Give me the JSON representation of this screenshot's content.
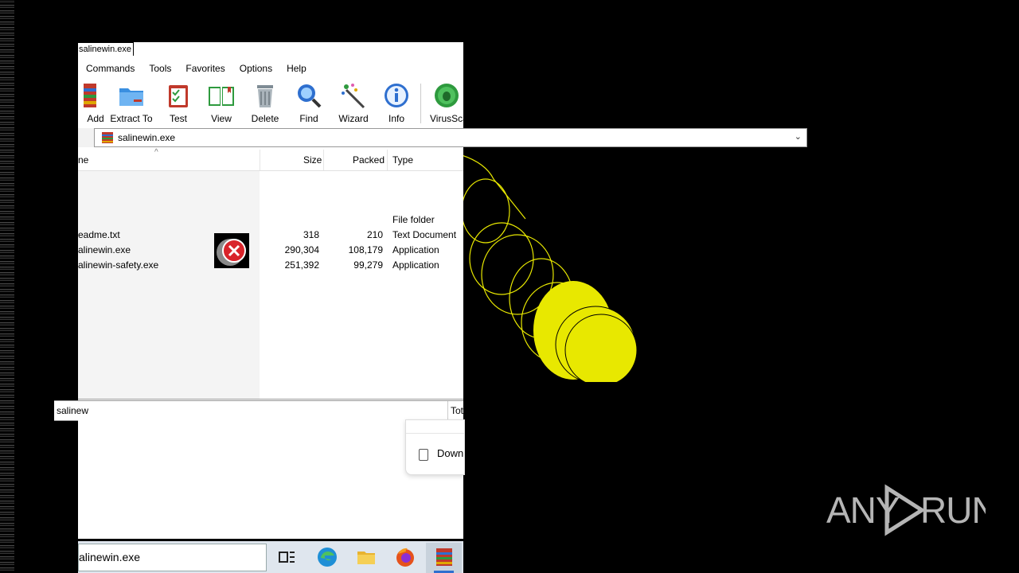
{
  "window": {
    "title": "salinewin.exe"
  },
  "menu": [
    "Commands",
    "Tools",
    "Favorites",
    "Options",
    "Help"
  ],
  "toolbar": [
    {
      "label": "Add",
      "icon": "add-archive-icon"
    },
    {
      "label": "Extract To",
      "icon": "extract-folder-icon"
    },
    {
      "label": "Test",
      "icon": "test-clipboard-icon"
    },
    {
      "label": "View",
      "icon": "view-book-icon"
    },
    {
      "label": "Delete",
      "icon": "trash-icon"
    },
    {
      "label": "Find",
      "icon": "magnifier-icon"
    },
    {
      "label": "Wizard",
      "icon": "wand-icon"
    },
    {
      "label": "Info",
      "icon": "info-icon"
    },
    {
      "label": "VirusSca",
      "icon": "virus-scan-icon"
    }
  ],
  "address": {
    "path": "salinewin.exe"
  },
  "columns": {
    "name": "ne",
    "size": "Size",
    "packed": "Packed",
    "type": "Type"
  },
  "files": [
    {
      "name": "",
      "size": "",
      "packed": "",
      "type": "File folder"
    },
    {
      "name": "eadme.txt",
      "size": "318",
      "packed": "210",
      "type": "Text Document"
    },
    {
      "name": "alinewin.exe",
      "size": "290,304",
      "packed": "108,179",
      "type": "Application"
    },
    {
      "name": "alinewin-safety.exe",
      "size": "251,392",
      "packed": "99,279",
      "type": "Application"
    }
  ],
  "status": {
    "left": "salinew",
    "right": "Tot"
  },
  "popup": {
    "download_label": "Down"
  },
  "taskbar": {
    "search_text": "alinewin.exe"
  },
  "watermark": "ANY RUN",
  "colors": {
    "payload_yellow": "#e8e800",
    "taskbar_bg": "#dfe6ee"
  }
}
